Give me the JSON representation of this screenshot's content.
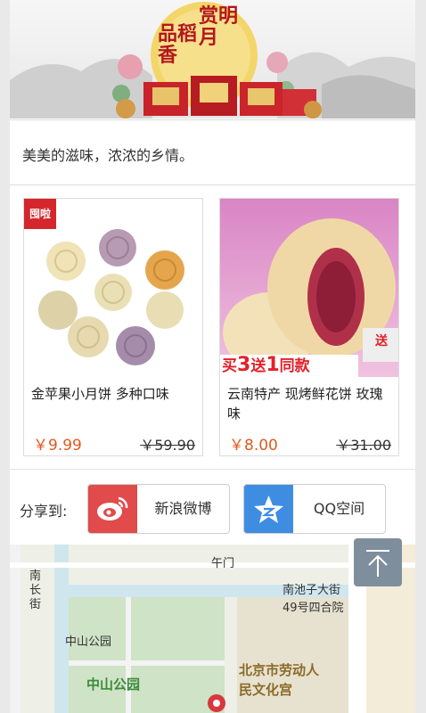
{
  "banner": {
    "seal_text_1": "品稻香",
    "seal_text_2": "赏明月"
  },
  "slogan": "美美的滋味，浓浓的乡情。",
  "products": [
    {
      "brand_logo": "囤啦",
      "title": "金苹果小月饼 多种口味",
      "price": "￥9.99",
      "old_price": "￥59.90"
    },
    {
      "promo_text_1": "买",
      "promo_num_1": "3",
      "promo_text_2": "送",
      "promo_num_2": "1",
      "promo_text_3": "同款",
      "promo_badge": "送",
      "title": "云南特产 现烤鲜花饼 玫瑰味",
      "price": "￥8.00",
      "old_price": "￥31.00"
    }
  ],
  "share": {
    "label": "分享到:",
    "weibo": "新浪微博",
    "qzone": "QQ空间"
  },
  "map": {
    "labels": {
      "wumen": "午门",
      "nanchang_street": "南长街",
      "nanchizi": "南池子大街",
      "courtyard": "49号四合院",
      "zhongshan_small": "中山公园",
      "zhongshan_big": "中山公园",
      "culture_palace": "北京市劳动人民文化宫"
    }
  },
  "colors": {
    "price": "#e05a1f",
    "weibo": "#e14b4b",
    "qzone": "#3e8de3",
    "back_top": "#7f8e9d"
  }
}
